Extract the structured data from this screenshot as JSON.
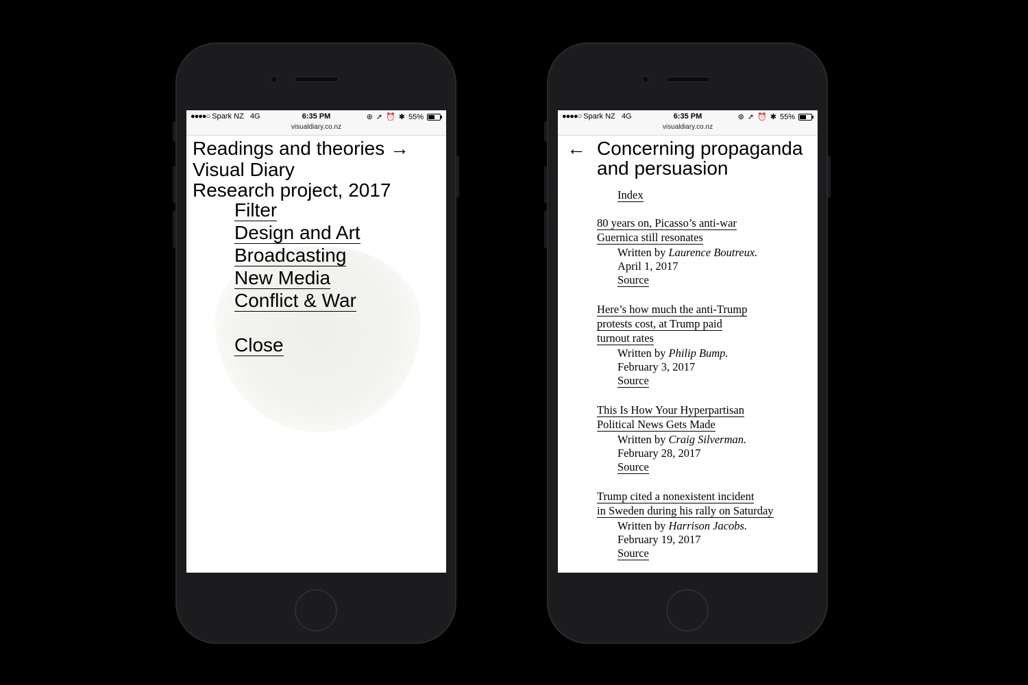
{
  "status_bar": {
    "carrier": "Spark NZ",
    "network": "4G",
    "time": "6:35 PM",
    "battery": "55%",
    "battery_level": 0.55,
    "url": "visualdiary.co.nz"
  },
  "left_screen": {
    "title_line1": "Readings and theories →",
    "title_line2": "Visual Diary",
    "title_line3": "Research project, 2017",
    "menu": [
      {
        "label": "Filter"
      },
      {
        "label": "Design and Art"
      },
      {
        "label": "Broadcasting"
      },
      {
        "label": "New Media"
      },
      {
        "label": "Conflict & War"
      }
    ],
    "close_label": "Close"
  },
  "right_screen": {
    "back_arrow": "←",
    "title": "Concerning propaganda and persuasion",
    "title_line1": "Concerning propaganda",
    "title_line2": "and persuasion",
    "index_label": "Index",
    "written_by": "Written by",
    "source_label": "Source",
    "articles": [
      {
        "title": "80 years on, Picasso’s anti-war Guernica still resonates",
        "author": "Laurence Boutreux.",
        "date": "April 1, 2017"
      },
      {
        "title": "Here’s how much the anti-Trump protests cost, at Trump paid turnout rates",
        "author": "Philip Bump.",
        "date": "February 3, 2017"
      },
      {
        "title": "This Is How Your Hyperpartisan Political News Gets Made",
        "author": "Craig Silverman.",
        "date": "February 28, 2017"
      },
      {
        "title": "Trump cited a nonexistent incident in Sweden during his rally on Saturday",
        "author": "Harrison Jacobs.",
        "date": "February 19, 2017"
      }
    ]
  }
}
